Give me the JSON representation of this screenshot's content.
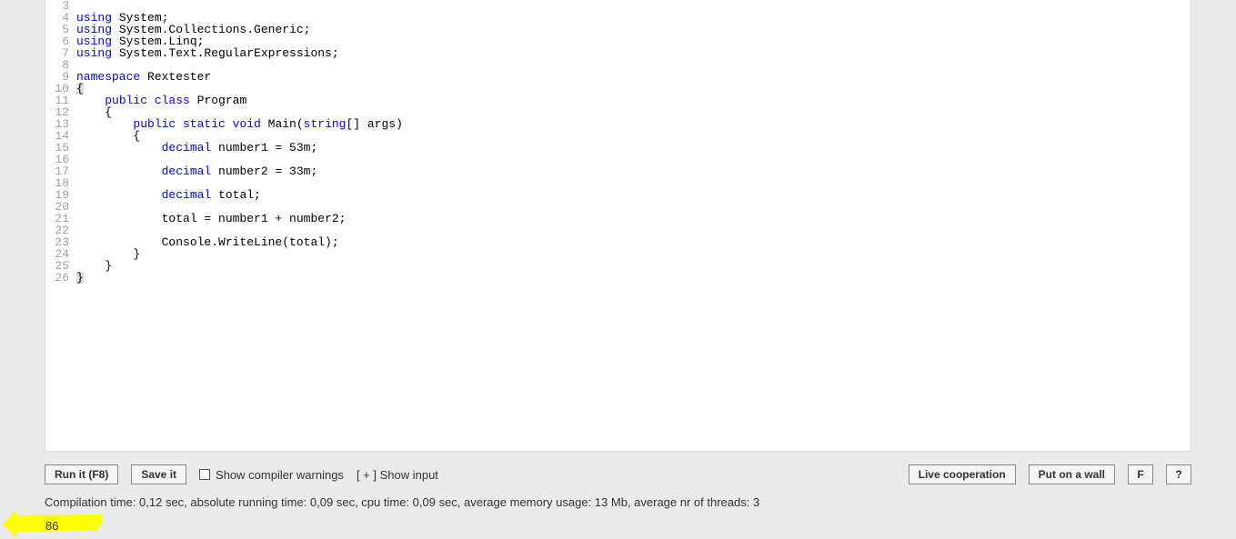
{
  "editor": {
    "gutter_start": 3,
    "gutter_end": 26,
    "lines": [
      {
        "n": 3,
        "tokens": []
      },
      {
        "n": 4,
        "tokens": [
          {
            "t": "using ",
            "c": "kw"
          },
          {
            "t": "System;",
            "c": "plain"
          }
        ]
      },
      {
        "n": 5,
        "tokens": [
          {
            "t": "using ",
            "c": "kw"
          },
          {
            "t": "System.Collections.Generic;",
            "c": "plain"
          }
        ]
      },
      {
        "n": 6,
        "tokens": [
          {
            "t": "using ",
            "c": "kw"
          },
          {
            "t": "System.Linq;",
            "c": "plain"
          }
        ]
      },
      {
        "n": 7,
        "tokens": [
          {
            "t": "using ",
            "c": "kw"
          },
          {
            "t": "System.Text.RegularExpressions;",
            "c": "plain"
          }
        ]
      },
      {
        "n": 8,
        "tokens": []
      },
      {
        "n": 9,
        "tokens": [
          {
            "t": "namespace ",
            "c": "kw"
          },
          {
            "t": "Rextester",
            "c": "plain"
          }
        ]
      },
      {
        "n": 10,
        "tokens": [
          {
            "t": "{",
            "c": "plain",
            "hl": true
          }
        ]
      },
      {
        "n": 11,
        "tokens": [
          {
            "t": "    ",
            "c": "plain"
          },
          {
            "t": "public class ",
            "c": "kw"
          },
          {
            "t": "Program",
            "c": "plain"
          }
        ]
      },
      {
        "n": 12,
        "tokens": [
          {
            "t": "    {",
            "c": "plain"
          }
        ]
      },
      {
        "n": 13,
        "tokens": [
          {
            "t": "        ",
            "c": "plain"
          },
          {
            "t": "public static void ",
            "c": "kw"
          },
          {
            "t": "Main(",
            "c": "plain"
          },
          {
            "t": "string",
            "c": "kw"
          },
          {
            "t": "[] args)",
            "c": "plain"
          }
        ]
      },
      {
        "n": 14,
        "tokens": [
          {
            "t": "        {",
            "c": "plain"
          }
        ]
      },
      {
        "n": 15,
        "tokens": [
          {
            "t": "            ",
            "c": "plain"
          },
          {
            "t": "decimal ",
            "c": "kw"
          },
          {
            "t": "number1 = 53m;",
            "c": "plain"
          }
        ]
      },
      {
        "n": 16,
        "tokens": []
      },
      {
        "n": 17,
        "tokens": [
          {
            "t": "            ",
            "c": "plain"
          },
          {
            "t": "decimal ",
            "c": "kw"
          },
          {
            "t": "number2 = 33m;",
            "c": "plain"
          }
        ]
      },
      {
        "n": 18,
        "tokens": []
      },
      {
        "n": 19,
        "tokens": [
          {
            "t": "            ",
            "c": "plain"
          },
          {
            "t": "decimal ",
            "c": "kw"
          },
          {
            "t": "total;",
            "c": "plain"
          }
        ]
      },
      {
        "n": 20,
        "tokens": []
      },
      {
        "n": 21,
        "tokens": [
          {
            "t": "            total = number1 + number2;",
            "c": "plain"
          }
        ]
      },
      {
        "n": 22,
        "tokens": []
      },
      {
        "n": 23,
        "tokens": [
          {
            "t": "            Console.WriteLine(total);",
            "c": "plain"
          }
        ]
      },
      {
        "n": 24,
        "tokens": [
          {
            "t": "        }",
            "c": "plain"
          }
        ]
      },
      {
        "n": 25,
        "tokens": [
          {
            "t": "    }",
            "c": "plain"
          }
        ]
      },
      {
        "n": 26,
        "tokens": [
          {
            "t": "}",
            "c": "plain",
            "hl": true
          }
        ]
      }
    ]
  },
  "controls": {
    "run": "Run it (F8)",
    "save": "Save it",
    "show_warnings": "Show compiler warnings",
    "show_input": "[ + ] Show input",
    "live": "Live cooperation",
    "wall": "Put on a wall",
    "f": "F",
    "q": "?"
  },
  "stats": "Compilation time: 0,12 sec, absolute running time: 0,09 sec, cpu time: 0,09 sec, average memory usage: 13 Mb, average nr of threads: 3",
  "output": "86"
}
